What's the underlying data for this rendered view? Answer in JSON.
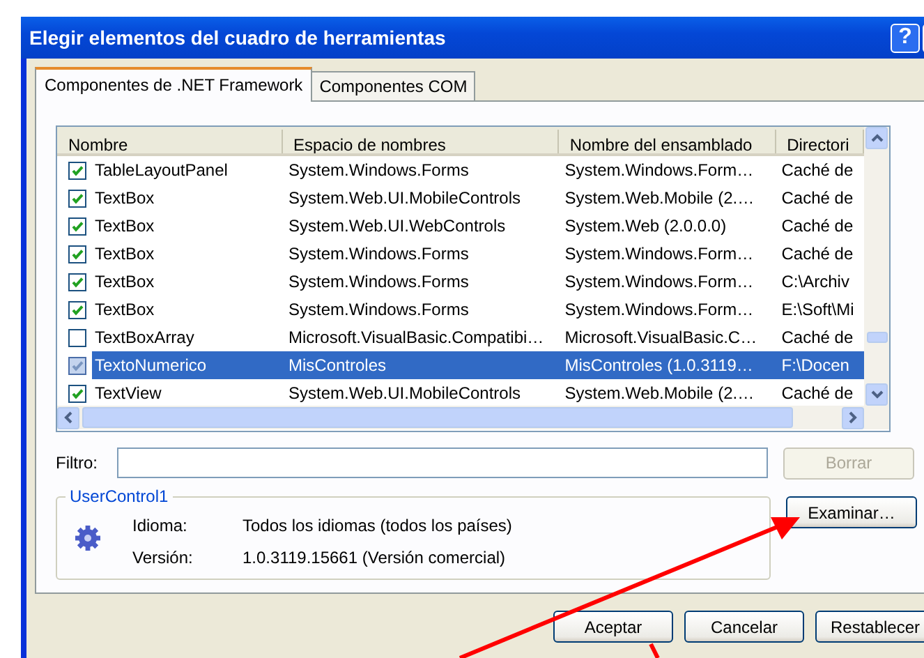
{
  "window": {
    "title": "Elegir elementos del cuadro de herramientas",
    "help_button": "?"
  },
  "tabs": [
    {
      "label": "Componentes de .NET Framework",
      "selected": true
    },
    {
      "label": "Componentes COM",
      "selected": false
    }
  ],
  "list": {
    "columns": [
      "Nombre",
      "Espacio de nombres",
      "Nombre del ensamblado",
      "Directori"
    ],
    "rows": [
      {
        "checked": true,
        "selected": false,
        "cells": [
          "TableLayoutPanel",
          "System.Windows.Forms",
          "System.Windows.Form…",
          "Caché de"
        ]
      },
      {
        "checked": true,
        "selected": false,
        "cells": [
          "TextBox",
          "System.Web.UI.MobileControls",
          "System.Web.Mobile (2.…",
          "Caché de"
        ]
      },
      {
        "checked": true,
        "selected": false,
        "cells": [
          "TextBox",
          "System.Web.UI.WebControls",
          "System.Web (2.0.0.0)",
          "Caché de"
        ]
      },
      {
        "checked": true,
        "selected": false,
        "cells": [
          "TextBox",
          "System.Windows.Forms",
          "System.Windows.Form…",
          "Caché de"
        ]
      },
      {
        "checked": true,
        "selected": false,
        "cells": [
          "TextBox",
          "System.Windows.Forms",
          "System.Windows.Form…",
          "C:\\Archiv"
        ]
      },
      {
        "checked": true,
        "selected": false,
        "cells": [
          "TextBox",
          "System.Windows.Forms",
          "System.Windows.Form…",
          "E:\\Soft\\Mi"
        ]
      },
      {
        "checked": false,
        "selected": false,
        "cells": [
          "TextBoxArray",
          "Microsoft.VisualBasic.Compatibi…",
          "Microsoft.VisualBasic.C…",
          "Caché de"
        ]
      },
      {
        "checked": true,
        "selected": true,
        "cells": [
          "TextoNumerico",
          "MisControles",
          "MisControles (1.0.3119…",
          "F:\\Docen"
        ]
      },
      {
        "checked": true,
        "selected": false,
        "cells": [
          "TextView",
          "System.Web.UI.MobileControls",
          "System.Web.Mobile (2.…",
          "Caché de"
        ]
      }
    ]
  },
  "filter": {
    "label": "Filtro:"
  },
  "clear_button": {
    "label": "Borrar",
    "disabled": true
  },
  "details": {
    "legend": "UserControl1",
    "rows": [
      {
        "label": "Idioma:",
        "value": "Todos los idiomas (todos los países)"
      },
      {
        "label": "Versión:",
        "value": "1.0.3119.15661 (Versión comercial)"
      }
    ]
  },
  "browse_button": {
    "label": "Examinar…",
    "disabled": false
  },
  "buttons": [
    {
      "label": "Aceptar"
    },
    {
      "label": "Cancelar"
    },
    {
      "label": "Restablecer"
    }
  ]
}
